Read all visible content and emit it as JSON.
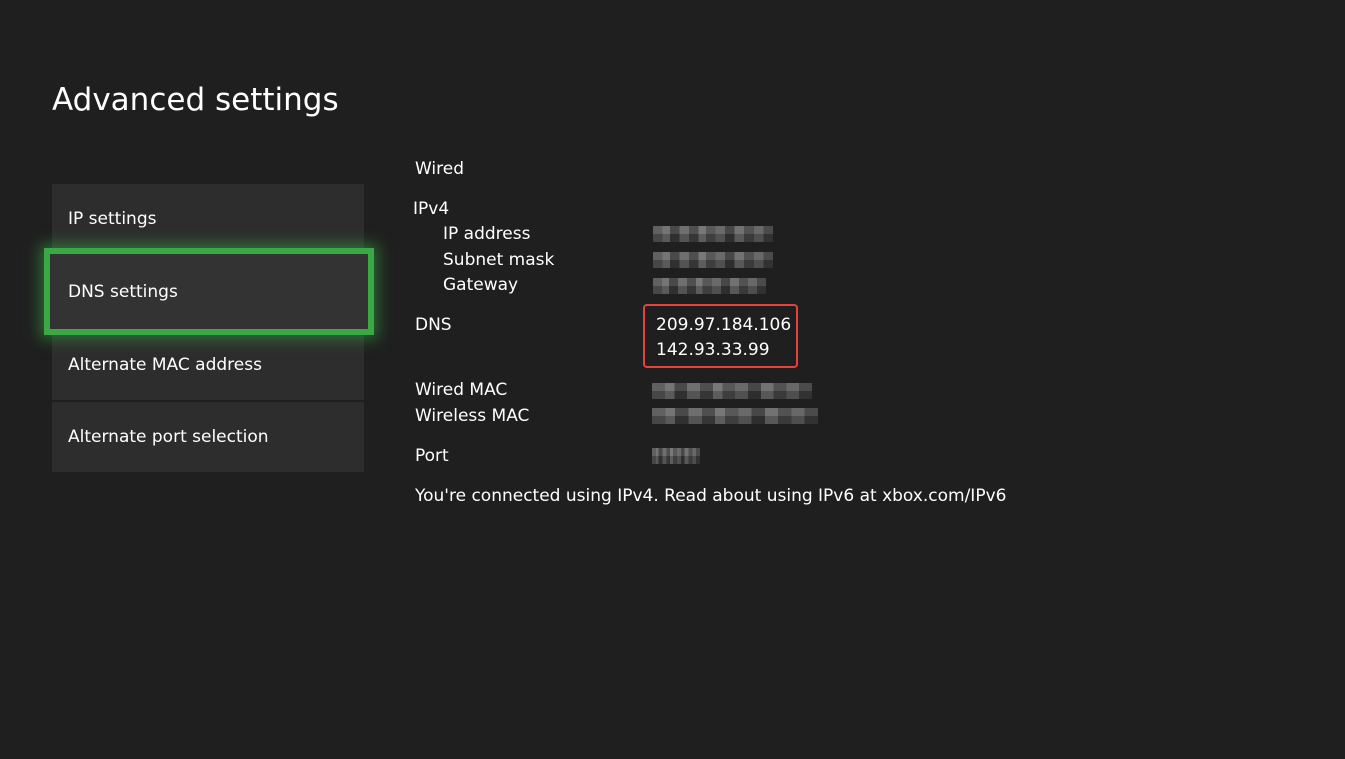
{
  "page": {
    "title": "Advanced settings"
  },
  "menu": {
    "items": [
      {
        "label": "IP settings"
      },
      {
        "label": "DNS settings",
        "focused": true
      },
      {
        "label": "Alternate MAC address"
      },
      {
        "label": "Alternate port selection"
      }
    ]
  },
  "details": {
    "connection_type": "Wired",
    "ipv4_heading": "IPv4",
    "ip_address_label": "IP address",
    "subnet_mask_label": "Subnet mask",
    "gateway_label": "Gateway",
    "dns_label": "DNS",
    "dns_primary": "209.97.184.106",
    "dns_secondary": "142.93.33.99",
    "wired_mac_label": "Wired MAC",
    "wireless_mac_label": "Wireless MAC",
    "port_label": "Port",
    "footer_note": "You're connected using IPv4. Read about using IPv6 at xbox.com/IPv6"
  },
  "colors": {
    "background": "#1f1f1f",
    "tile": "#2d2d2d",
    "focus_accent": "#39a845",
    "annotation": "#e5413d",
    "text": "#ffffff"
  }
}
